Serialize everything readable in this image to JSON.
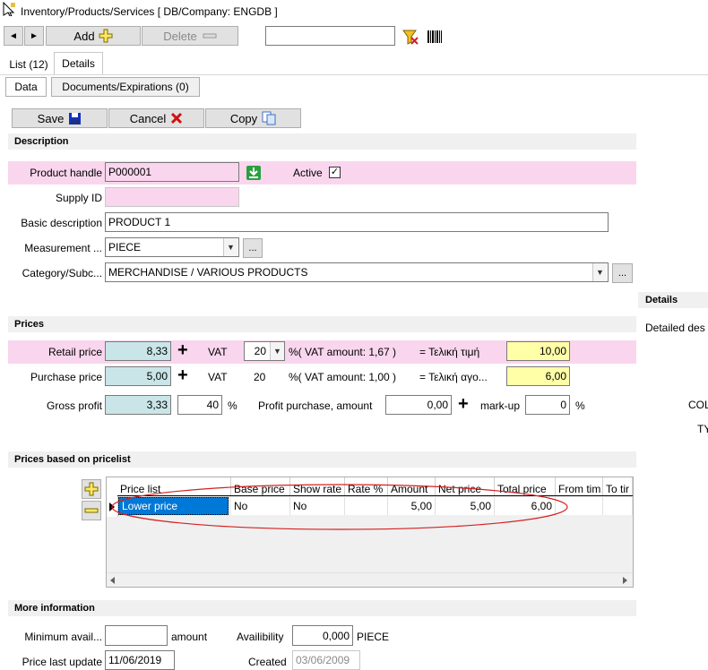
{
  "window": {
    "title": "Inventory/Products/Services   [ DB/Company: ENGDB ]"
  },
  "toolbar": {
    "prev": "◄",
    "next": "►",
    "add": "Add",
    "delete": "Delete",
    "search_value": ""
  },
  "tabs": {
    "list": "List (12)",
    "details": "Details"
  },
  "subtabs": {
    "data": "Data",
    "documents": "Documents/Expirations (0)"
  },
  "actions": {
    "save": "Save",
    "cancel": "Cancel",
    "copy": "Copy"
  },
  "description": {
    "header": "Description",
    "product_handle_label": "Product handle",
    "product_handle": "P000001",
    "active_label": "Active",
    "active_mark": "✓",
    "supply_id_label": "Supply ID",
    "supply_id": "",
    "basic_description_label": "Basic description",
    "basic_description": "PRODUCT 1",
    "measurement_label": "Measurement ...",
    "measurement": "PIECE",
    "category_label": "Category/Subc...",
    "category": "MERCHANDISE / VARIOUS PRODUCTS",
    "ellipsis": "..."
  },
  "prices": {
    "header": "Prices",
    "retail_label": "Retail price",
    "retail": "8,33",
    "vat_label": "VAT",
    "retail_vat": "20",
    "retail_vat_text": "%( VAT amount: 1,67 )",
    "retail_final_label": "= Τελική τιμή",
    "retail_final": "10,00",
    "purchase_label": "Purchase price",
    "purchase": "5,00",
    "purchase_vat": "20",
    "purchase_vat_text": "%( VAT amount: 1,00 )",
    "purchase_final_label": "= Τελική αγο...",
    "purchase_final": "6,00",
    "gross_label": "Gross profit",
    "gross": "3,33",
    "gross_pct": "40",
    "pct": "%",
    "profit_amount_label": "Profit purchase, amount",
    "profit_amount": "0,00",
    "markup_label": "mark-up",
    "markup": "0"
  },
  "pricelist": {
    "header": "Prices based on pricelist",
    "columns": [
      "Price list",
      "Base price",
      "Show rate",
      "Rate %",
      "Amount",
      "Net price",
      "Total price",
      "From tim",
      "To tir"
    ],
    "rows": [
      {
        "price_list": "Lower price",
        "base_price": "No",
        "show_rate": "No",
        "rate": "",
        "amount": "5,00",
        "net_price": "5,00",
        "total_price": "6,00",
        "from": "",
        "to": ""
      }
    ]
  },
  "more": {
    "header": "More information",
    "min_avail_label": "Minimum avail...",
    "min_avail": "",
    "amount_label": "amount",
    "availability_label": "Availibility",
    "availability": "0,000",
    "availability_unit": "PIECE",
    "last_update_label": "Price last update",
    "last_update": "11/06/2019",
    "created_label": "Created",
    "created": "03/06/2009"
  },
  "side": {
    "details_header": "Details",
    "detailed_desc": "Detailed des",
    "col": "COL",
    "ty": "TY"
  },
  "colors": {
    "pink": "#f9d6ee",
    "blue": "#c9e5e8",
    "yellow": "#ffffa8",
    "selection": "#0078d7",
    "annotation": "#d62020"
  }
}
